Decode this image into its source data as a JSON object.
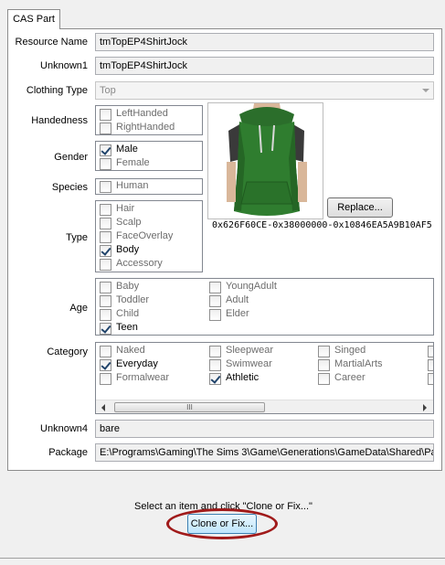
{
  "tab": {
    "label": "CAS Part"
  },
  "fields": {
    "resource_name": {
      "label": "Resource Name",
      "value": "tmTopEP4ShirtJock"
    },
    "unknown1": {
      "label": "Unknown1",
      "value": "tmTopEP4ShirtJock"
    },
    "clothing_type": {
      "label": "Clothing Type",
      "value": "Top"
    },
    "unknown4": {
      "label": "Unknown4",
      "value": "bare"
    },
    "package": {
      "label": "Package",
      "value": "E:\\Programs\\Gaming\\The Sims 3\\Game\\Generations\\GameData\\Shared\\Pa"
    }
  },
  "handedness": {
    "label": "Handedness",
    "options": [
      {
        "label": "LeftHanded",
        "checked": false
      },
      {
        "label": "RightHanded",
        "checked": false
      }
    ]
  },
  "gender": {
    "label": "Gender",
    "options": [
      {
        "label": "Male",
        "checked": true
      },
      {
        "label": "Female",
        "checked": false
      }
    ]
  },
  "species": {
    "label": "Species",
    "options": [
      {
        "label": "Human",
        "checked": false
      }
    ]
  },
  "type": {
    "label": "Type",
    "options": [
      {
        "label": "Hair",
        "checked": false
      },
      {
        "label": "Scalp",
        "checked": false
      },
      {
        "label": "FaceOverlay",
        "checked": false
      },
      {
        "label": "Body",
        "checked": true
      },
      {
        "label": "Accessory",
        "checked": false
      }
    ]
  },
  "age": {
    "label": "Age",
    "options": [
      {
        "label": "Baby",
        "checked": false
      },
      {
        "label": "Toddler",
        "checked": false
      },
      {
        "label": "Child",
        "checked": false
      },
      {
        "label": "Teen",
        "checked": true
      },
      {
        "label": "YoungAdult",
        "checked": false
      },
      {
        "label": "Adult",
        "checked": false
      },
      {
        "label": "Elder",
        "checked": false
      }
    ]
  },
  "category": {
    "label": "Category",
    "options": [
      {
        "label": "Naked",
        "checked": false
      },
      {
        "label": "Everyday",
        "checked": true
      },
      {
        "label": "Formalwear",
        "checked": false
      },
      {
        "label": "Sleepwear",
        "checked": false
      },
      {
        "label": "Swimwear",
        "checked": false
      },
      {
        "label": "Athletic",
        "checked": true
      },
      {
        "label": "Singed",
        "checked": false
      },
      {
        "label": "MartialArts",
        "checked": false
      },
      {
        "label": "Career",
        "checked": false
      }
    ],
    "scroll_grip": "III"
  },
  "preview": {
    "replace_label": "Replace...",
    "hash": "0x626F60CE-0x38000000-0x10846EA5A9B10AF5"
  },
  "status": {
    "text": "Select an item and click \"Clone or Fix...\"",
    "button_label": "Clone or Fix..."
  },
  "colors": {
    "highlight_ring": "#a01a1a",
    "shirt": "#2f7d2f"
  }
}
